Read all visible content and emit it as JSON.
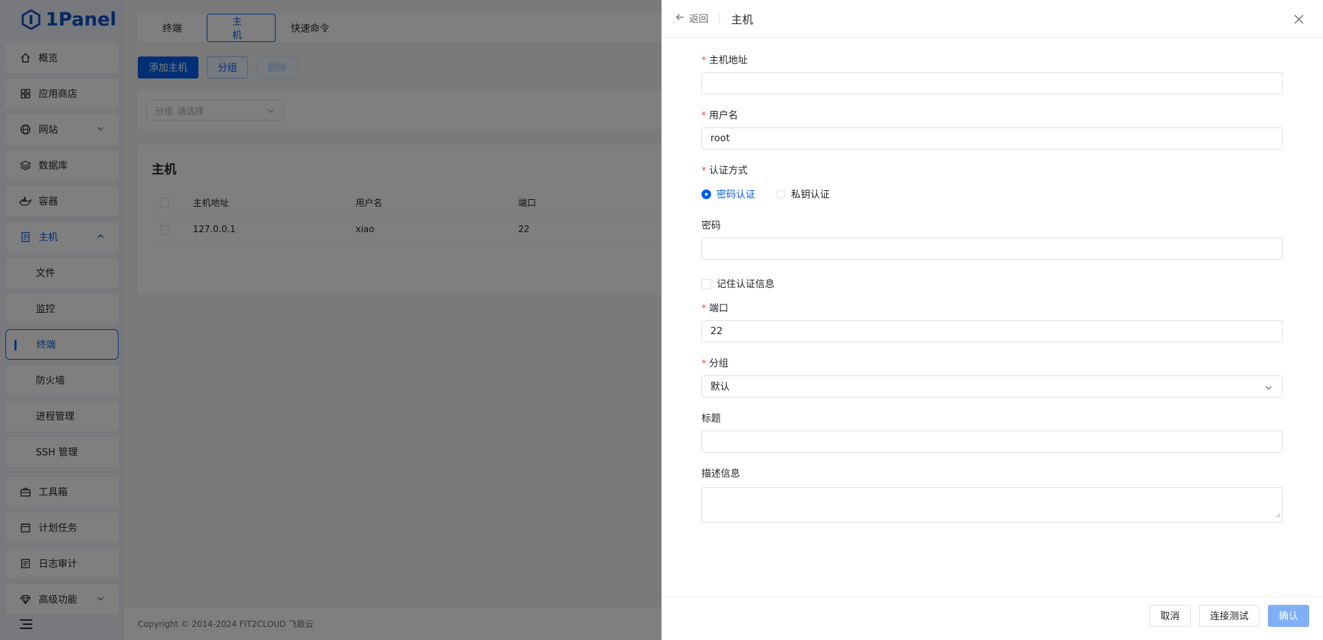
{
  "app": {
    "logo_text": "1Panel",
    "accent": "#005eeb"
  },
  "sidebar": {
    "items": [
      {
        "label": "概览",
        "icon": "home-icon"
      },
      {
        "label": "应用商店",
        "icon": "grid-icon"
      },
      {
        "label": "网站",
        "icon": "globe-icon"
      },
      {
        "label": "数据库",
        "icon": "layers-icon"
      },
      {
        "label": "容器",
        "icon": "docker-icon"
      },
      {
        "label": "主机",
        "icon": "server-icon"
      },
      {
        "label": "文件"
      },
      {
        "label": "监控"
      },
      {
        "label": "终端"
      },
      {
        "label": "防火墙"
      },
      {
        "label": "进程管理"
      },
      {
        "label": "SSH 管理"
      },
      {
        "label": "工具箱",
        "icon": "toolbox-icon"
      },
      {
        "label": "计划任务",
        "icon": "calendar-icon"
      },
      {
        "label": "日志审计",
        "icon": "log-icon"
      },
      {
        "label": "高级功能",
        "icon": "diamond-icon"
      }
    ]
  },
  "main": {
    "tabs": [
      {
        "label": "终端"
      },
      {
        "label": "主机"
      },
      {
        "label": "快速命令"
      }
    ],
    "toolbar": {
      "add_label": "添加主机",
      "group_label": "分组",
      "delete_label": "删除"
    },
    "filter": {
      "label": "分组",
      "placeholder": "请选择"
    },
    "card_title": "主机",
    "table": {
      "headers": [
        "主机地址",
        "用户名",
        "端口"
      ],
      "rows": [
        [
          "127.0.0.1",
          "xiao",
          "22"
        ]
      ]
    },
    "footer": "Copyright © 2014-2024 FIT2CLOUD 飞致云"
  },
  "drawer": {
    "back_label": "返回",
    "title": "主机",
    "fields": {
      "addr_label": "主机地址",
      "addr_value": "",
      "user_label": "用户名",
      "user_value": "root",
      "auth_label": "认证方式",
      "auth_password": "密码认证",
      "auth_key": "私钥认证",
      "password_label": "密码",
      "remember_label": "记住认证信息",
      "port_label": "端口",
      "port_value": "22",
      "group_label": "分组",
      "group_value": "默认",
      "title_label": "标题",
      "desc_label": "描述信息"
    },
    "buttons": {
      "cancel": "取消",
      "test": "连接测试",
      "confirm": "确认"
    }
  }
}
